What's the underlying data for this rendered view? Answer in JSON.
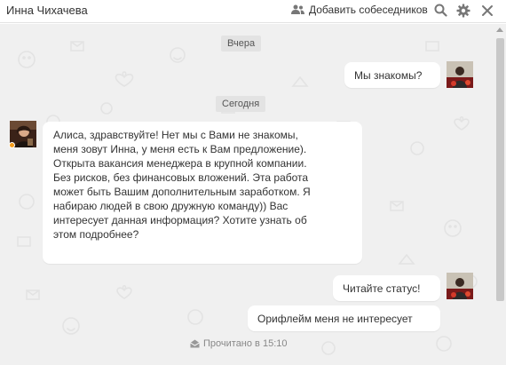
{
  "header": {
    "title": "Инна Чихачева",
    "add_participants_label": "Добавить собеседников",
    "icons": [
      "add-people-icon",
      "search-icon",
      "gear-icon",
      "close-icon"
    ]
  },
  "chat": {
    "date_yesterday": "Вчера",
    "date_today": "Сегодня",
    "messages": [
      {
        "direction": "outgoing",
        "text": "Мы знакомы?"
      },
      {
        "direction": "incoming",
        "text": "Алиса, здравствуйте! Нет мы с Вами не знакомы,\nменя зовут Инна, у меня есть к Вам предложение).\nОткрыта вакансия менеджера в крупной компании.\nБез рисков, без финансовых вложений. Эта работа\nможет быть Вашим дополнительным заработком. Я\nнабираю людей в свою дружную команду)) Вас\nинтересует данная информация? Хотите узнать об\nэтом подробнее?"
      },
      {
        "direction": "outgoing",
        "text": "Читайте статус!"
      },
      {
        "direction": "outgoing",
        "text": "Орифлейм меня не интересует"
      }
    ],
    "read_status": "Прочитано в 15:10"
  },
  "colors": {
    "background": "#f0f0f0",
    "bubble": "#ffffff",
    "date_pill": "#e3e3e3",
    "online_indicator": "#f59c1a",
    "text": "#333333"
  }
}
